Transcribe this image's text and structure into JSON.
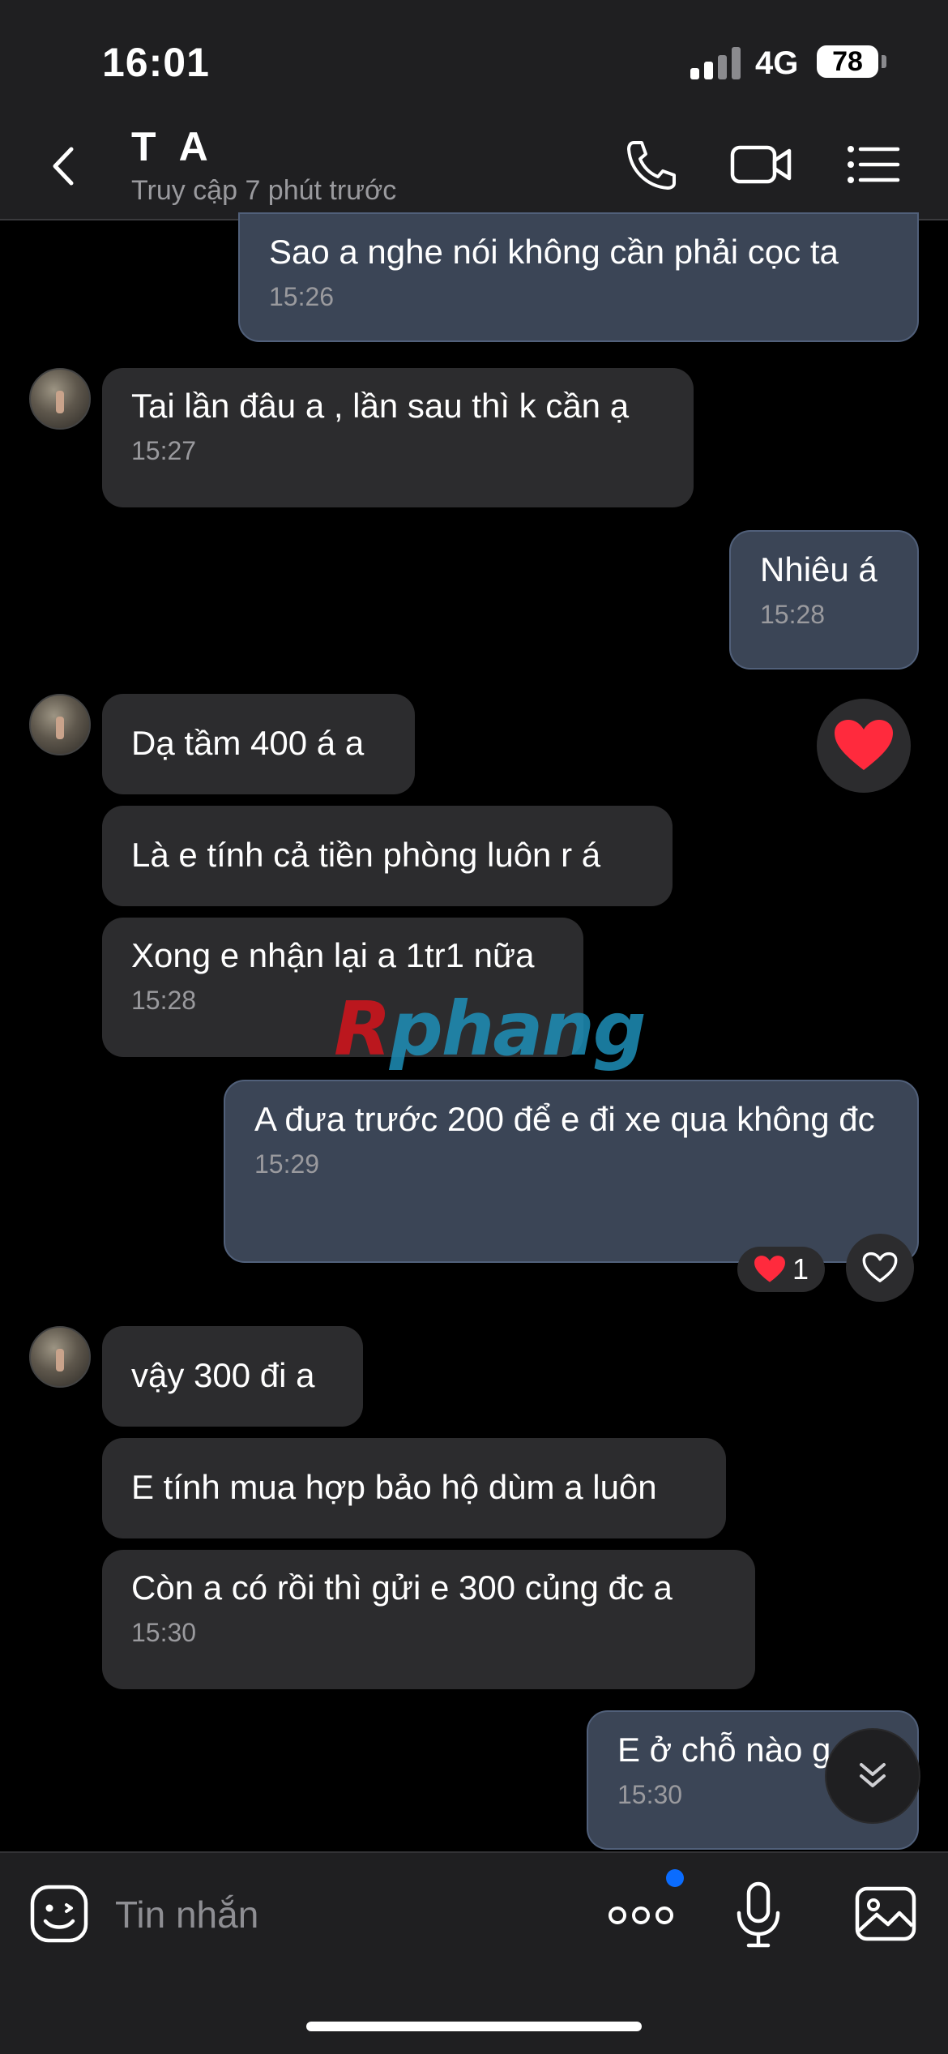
{
  "status_bar": {
    "time": "16:01",
    "network": "4G",
    "battery": "78"
  },
  "header": {
    "contact_name": "T A",
    "contact_status": "Truy cập 7 phút trước"
  },
  "messages": [
    {
      "dir": "out",
      "text": "Sao a nghe nói không cần phải cọc ta",
      "time": "15:26"
    },
    {
      "dir": "in",
      "text": "Tai lần đâu a , lần sau thì k cần ạ",
      "time": "15:27"
    },
    {
      "dir": "out",
      "text": "Nhiêu á",
      "time": "15:28"
    },
    {
      "dir": "in",
      "text": "Dạ tầm 400 á a",
      "time": ""
    },
    {
      "dir": "in",
      "text": "Là e tính cả tiền phòng luôn r á",
      "time": ""
    },
    {
      "dir": "in",
      "text": "Xong e nhận lại a 1tr1 nữa",
      "time": "15:28"
    },
    {
      "dir": "out",
      "text": "A đưa trước 200 để e đi xe qua không đc",
      "time": "15:29"
    },
    {
      "dir": "in",
      "text": "vậy 300 đi a",
      "time": ""
    },
    {
      "dir": "in",
      "text": "E tính mua hợp bảo hộ dùm a luôn",
      "time": ""
    },
    {
      "dir": "in",
      "text": "Còn a có rồi thì gửi e 300 củng đc a",
      "time": "15:30"
    },
    {
      "dir": "out",
      "text": "E ở chỗ nào g",
      "time": "15:30"
    }
  ],
  "reactions": {
    "heart_count": "1"
  },
  "watermark": {
    "first": "R",
    "rest": "phang"
  },
  "input": {
    "placeholder": "Tin nhắn"
  },
  "colors": {
    "background": "#000000",
    "incoming_bubble": "#2c2c2e",
    "outgoing_bubble": "#3b4556",
    "heart": "#ff2a3d",
    "badge": "#0a6cff"
  },
  "icons": [
    "back-arrow-icon",
    "phone-icon",
    "video-camera-icon",
    "menu-list-icon",
    "heart-icon",
    "heart-outline-icon",
    "chevron-double-down-icon",
    "emoji-sticker-icon",
    "more-dots-icon",
    "microphone-icon",
    "image-icon"
  ]
}
